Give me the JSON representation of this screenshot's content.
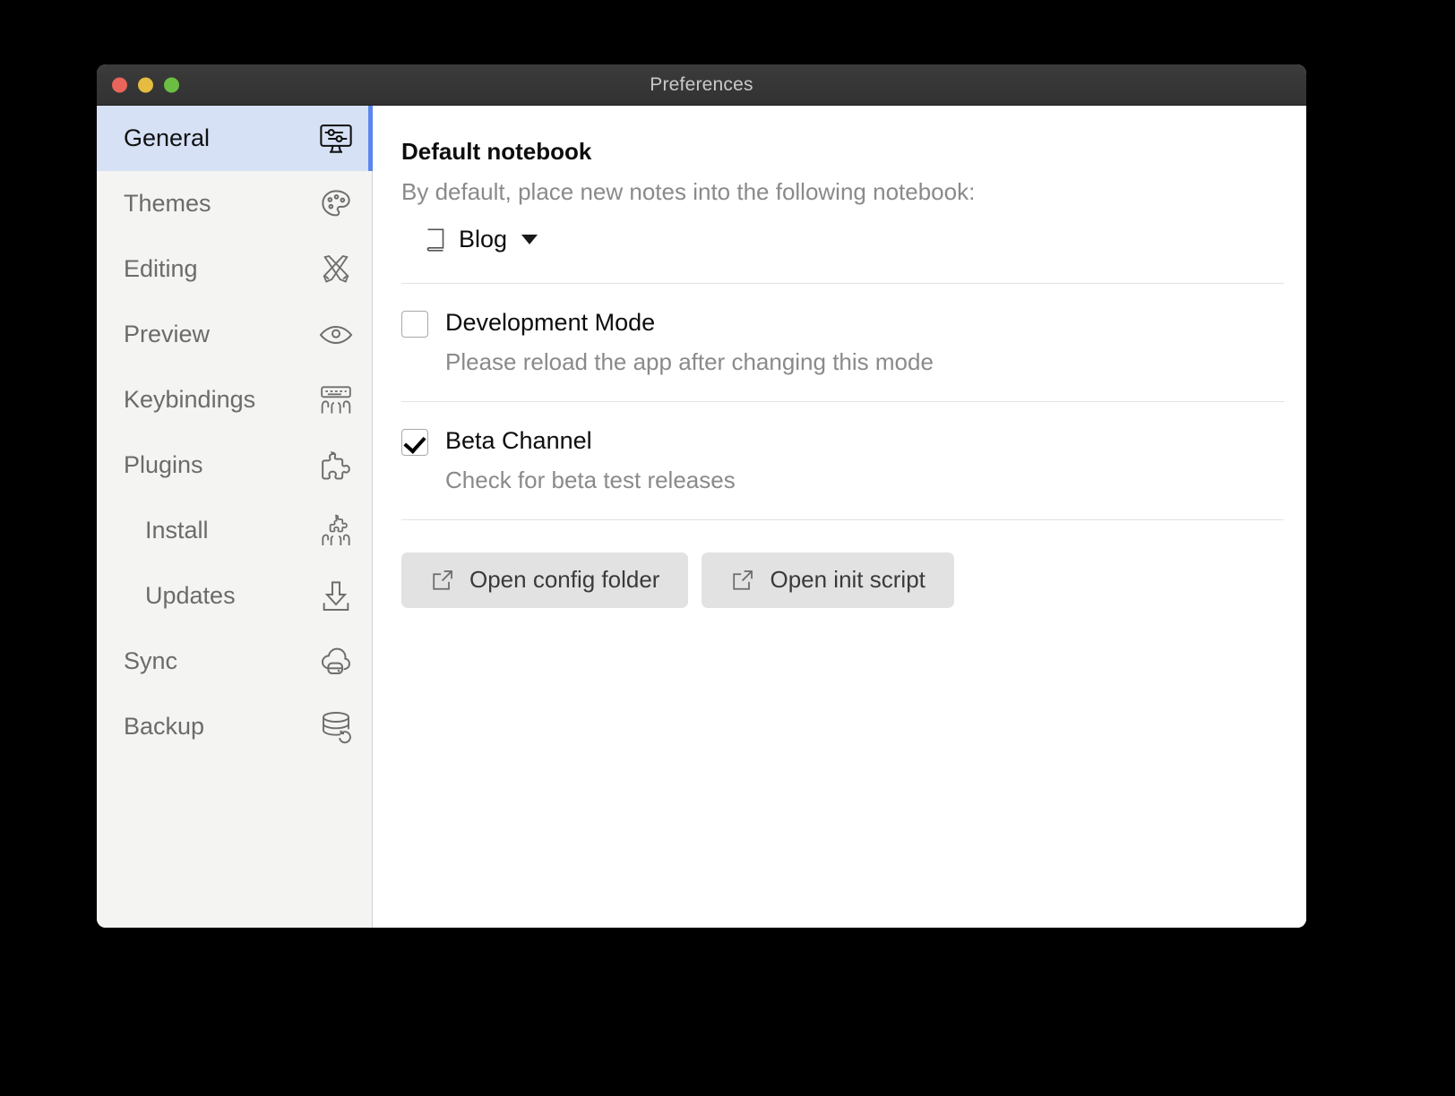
{
  "window": {
    "title": "Preferences",
    "traffic_lights": [
      {
        "name": "close",
        "color": "#e9655b"
      },
      {
        "name": "minimize",
        "color": "#e4bc3f"
      },
      {
        "name": "zoom",
        "color": "#6cbe43"
      }
    ]
  },
  "sidebar": {
    "selected_index": 0,
    "accent_color": "#5a86ee",
    "selected_bg": "#d6e1f5",
    "items": [
      {
        "label": "General",
        "icon": "monitor-sliders-icon",
        "sub": false,
        "selected": true
      },
      {
        "label": "Themes",
        "icon": "palette-icon",
        "sub": false,
        "selected": false
      },
      {
        "label": "Editing",
        "icon": "crossed-pens-icon",
        "sub": false,
        "selected": false
      },
      {
        "label": "Preview",
        "icon": "eye-icon",
        "sub": false,
        "selected": false
      },
      {
        "label": "Keybindings",
        "icon": "keyboard-hands-icon",
        "sub": false,
        "selected": false
      },
      {
        "label": "Plugins",
        "icon": "puzzle-piece-icon",
        "sub": false,
        "selected": false
      },
      {
        "label": "Install",
        "icon": "puzzle-hands-icon",
        "sub": true,
        "selected": false
      },
      {
        "label": "Updates",
        "icon": "download-icon",
        "sub": true,
        "selected": false
      },
      {
        "label": "Sync",
        "icon": "cloud-sync-icon",
        "sub": false,
        "selected": false
      },
      {
        "label": "Backup",
        "icon": "database-refresh-icon",
        "sub": false,
        "selected": false
      }
    ]
  },
  "main": {
    "section_title": "Default notebook",
    "section_desc": "By default, place new notes into the following notebook:",
    "notebook": {
      "icon": "book-icon",
      "value": "Blog"
    },
    "settings": [
      {
        "name": "development-mode",
        "label": "Development Mode",
        "sub": "Please reload the app after changing this mode",
        "checked": false
      },
      {
        "name": "beta-channel",
        "label": "Beta Channel",
        "sub": "Check for beta test releases",
        "checked": true
      }
    ],
    "buttons": [
      {
        "name": "open-config-folder",
        "label": "Open config folder",
        "icon": "external-link-icon"
      },
      {
        "name": "open-init-script",
        "label": "Open init script",
        "icon": "external-link-icon"
      }
    ]
  }
}
